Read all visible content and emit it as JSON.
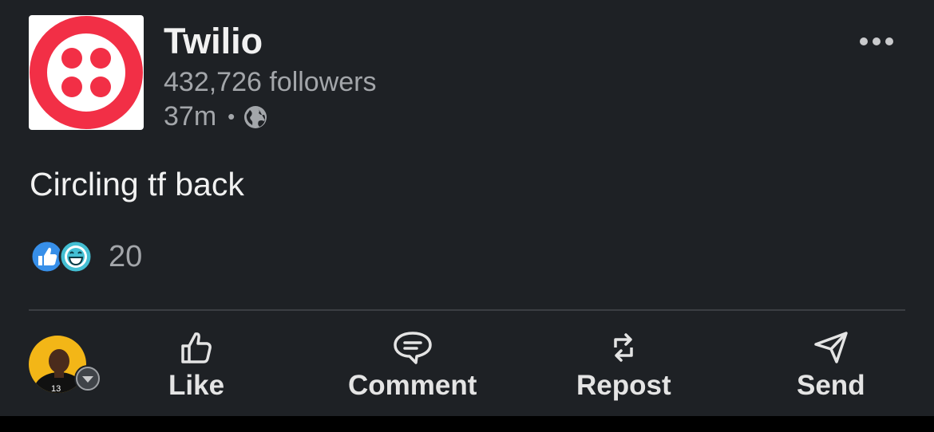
{
  "post": {
    "author": "Twilio",
    "followers": "432,726 followers",
    "time": "37m",
    "separator": "•",
    "text": "Circling tf back",
    "reaction_count": "20",
    "reaction_icons": [
      "like-icon",
      "funny-icon"
    ]
  },
  "actions": {
    "like": "Like",
    "comment": "Comment",
    "repost": "Repost",
    "send": "Send"
  },
  "colors": {
    "background": "#1e2125",
    "twilio_red": "#f22f46",
    "muted_text": "#a3a6aa",
    "like_blue": "#378fe9",
    "funny_teal": "#44bfd3"
  }
}
